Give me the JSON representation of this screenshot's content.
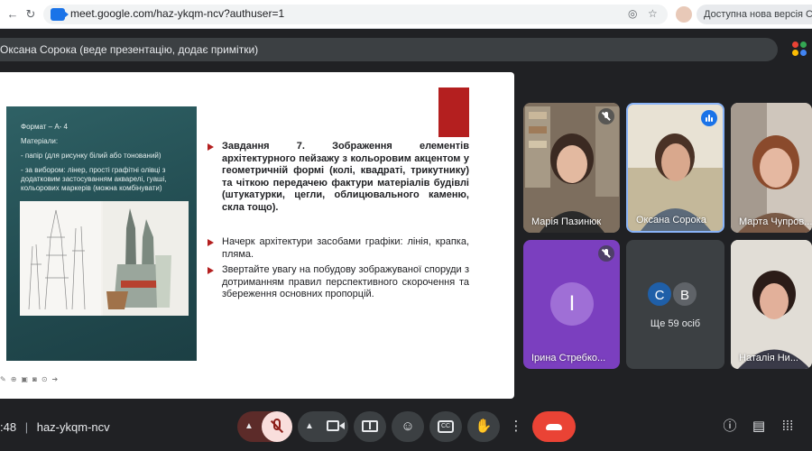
{
  "browser": {
    "url": "meet.google.com/haz-ykqm-ncv?authuser=1",
    "update_notice": "Доступна нова версія Chrome"
  },
  "meeting": {
    "presenter_banner": "Оксана Сорока (веде презентацію, додає примітки)",
    "time": ":48",
    "separator": "|",
    "code": "haz-ykqm-ncv"
  },
  "slide": {
    "panel": {
      "format": "Формат – А- 4",
      "materials_title": "Матеріали:",
      "paper": "- папір (для рисунку білий або тонований)",
      "choice": "- за вибором: лінер, прості графітні олівці з додатковим застосуванням акварелі, гуаші, кольорових маркерів (можна комбінувати)"
    },
    "task": "Завдання 7. Зображення елементів архітектурного пейзажу з кольоровим акцентом у геометричній формі (колі, квадраті, трикутнику) та чіткою передачею фактури матеріалів будівлі (штукатурки, цегли, облицювального каменю, скла тощо).",
    "point2": "Начерк архітектури засобами графіки: лінія, крапка, пляма.",
    "point3": "Звертайте увагу на побудову зображуваної споруди з дотриманням правил перспективного скорочення та збереження основних пропорцій."
  },
  "participants": [
    {
      "name": "Марія Пазинюк",
      "muted": true
    },
    {
      "name": "Оксана Сорока",
      "speaking": true
    },
    {
      "name": "Марта Чупров..."
    },
    {
      "name": "Ірина Стребко...",
      "initial": "І",
      "muted": true,
      "color": "#7b3fbf"
    },
    {
      "more_label": "Ще 59 осіб",
      "initials": [
        "С",
        "В"
      ]
    },
    {
      "name": "Наталія Ни..."
    }
  ],
  "colors": {
    "accent_red": "#b41f1f",
    "end_call": "#ea4335",
    "teal_panel": "#2a575b"
  },
  "icons": [
    "back-arrow-icon",
    "reload-icon",
    "eye-off-icon",
    "star-icon",
    "mic-off-icon",
    "camera-icon",
    "present-icon",
    "emoji-icon",
    "captions-icon",
    "raise-hand-icon",
    "more-icon",
    "hang-up-icon",
    "info-icon",
    "chat-icon",
    "activities-icon"
  ]
}
